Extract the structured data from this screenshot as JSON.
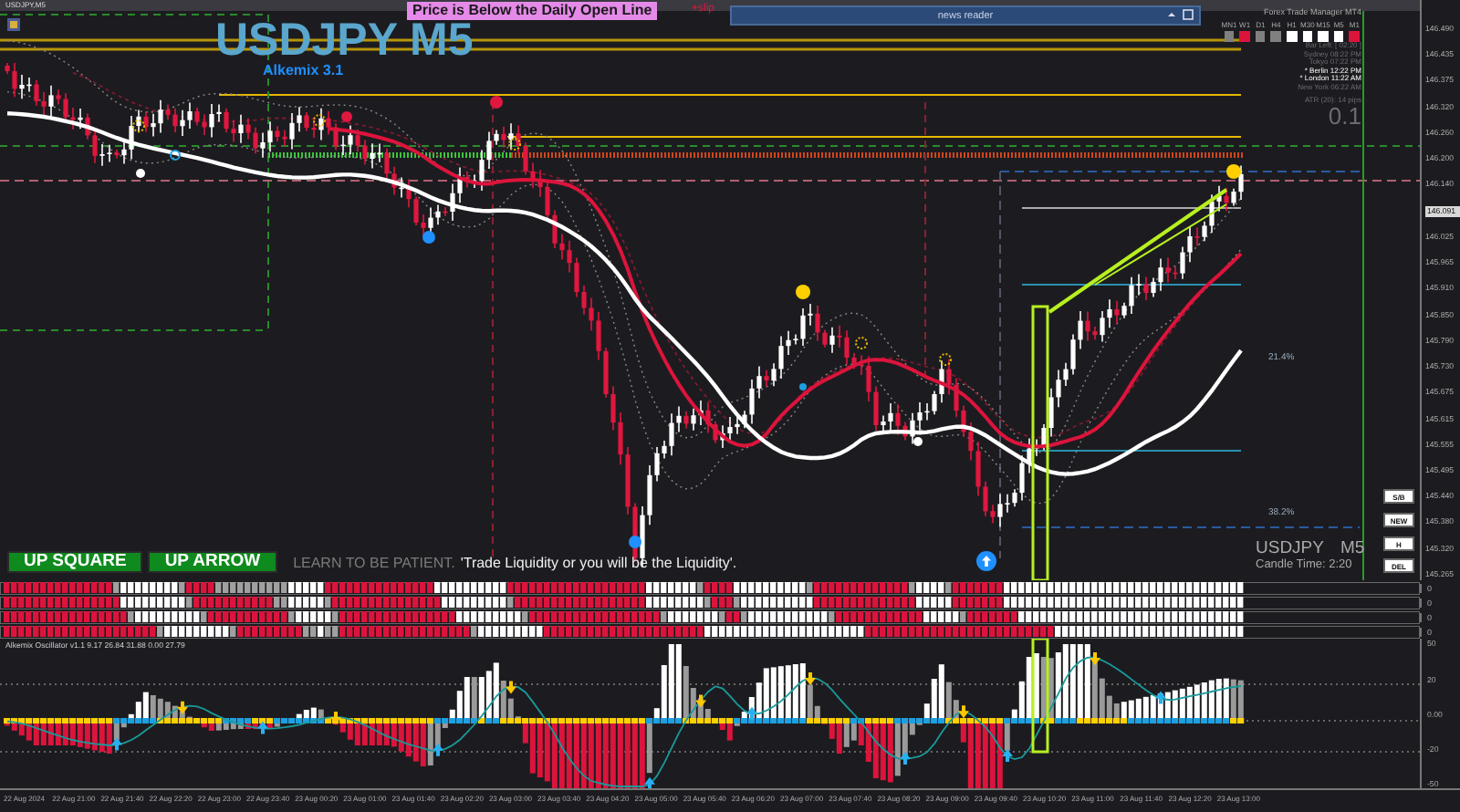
{
  "window": {
    "title": "USDJPY,M5"
  },
  "chart": {
    "symbol_title": "USDJPY M5",
    "subtitle": "Alkemix 3.1",
    "alert": "Price is Below the Daily Open Line",
    "alert_tag": "+slip",
    "fib_levels": [
      {
        "label": "21.4%"
      },
      {
        "label": "38.2%"
      }
    ],
    "price_axis": [
      {
        "label": "146.490",
        "current": false
      },
      {
        "label": "146.435",
        "current": false
      },
      {
        "label": "146.375",
        "current": false
      },
      {
        "label": "146.320",
        "current": false
      },
      {
        "label": "146.260",
        "current": false
      },
      {
        "label": "146.200",
        "current": false
      },
      {
        "label": "146.140",
        "current": false
      },
      {
        "label": "146.091",
        "current": true
      },
      {
        "label": "146.025",
        "current": false
      },
      {
        "label": "145.965",
        "current": false
      },
      {
        "label": "145.910",
        "current": false
      },
      {
        "label": "145.850",
        "current": false
      },
      {
        "label": "145.790",
        "current": false
      },
      {
        "label": "145.730",
        "current": false
      },
      {
        "label": "145.675",
        "current": false
      },
      {
        "label": "145.615",
        "current": false
      },
      {
        "label": "145.555",
        "current": false
      },
      {
        "label": "145.495",
        "current": false
      },
      {
        "label": "145.440",
        "current": false
      },
      {
        "label": "145.380",
        "current": false
      },
      {
        "label": "145.320",
        "current": false
      },
      {
        "label": "145.265",
        "current": false
      }
    ]
  },
  "news_reader": {
    "title": "news reader"
  },
  "trade_manager": {
    "title": "Forex Trade Manager MT4",
    "timeframes": [
      {
        "label": "MN1",
        "color": "#808080"
      },
      {
        "label": "W1",
        "color": "#dc143c"
      },
      {
        "label": "D1",
        "color": "#808080"
      },
      {
        "label": "H4",
        "color": "#808080"
      },
      {
        "label": "H1",
        "color": "#ffffff"
      },
      {
        "label": "M30",
        "color": "#ffffff"
      },
      {
        "label": "M15",
        "color": "#ffffff"
      },
      {
        "label": "M5",
        "color": "#ffffff"
      },
      {
        "label": "M1",
        "color": "#dc143c"
      }
    ],
    "sessions": [
      {
        "text": "Bar Left: [ 02:20 ]",
        "highlighted": false
      },
      {
        "text": "Sydney 08:22 PM",
        "highlighted": false
      },
      {
        "text": "Tokyo 07:22 PM",
        "highlighted": false
      },
      {
        "text": "* Berlin 12:22 PM",
        "highlighted": true
      },
      {
        "text": "* London 11:22 AM",
        "highlighted": true
      },
      {
        "text": "New York 06:22 AM",
        "highlighted": false
      }
    ],
    "atr": "ATR (20): 14 pips",
    "lot": "0.1"
  },
  "candle_info": {
    "symbol": "USDJPY",
    "timeframe": "M5",
    "candle_time": "Candle Time: 2:20"
  },
  "side_buttons": [
    "S/B",
    "NEW",
    "H",
    "DEL"
  ],
  "signals": [
    {
      "label": "UP SQUARE"
    },
    {
      "label": "UP ARROW"
    }
  ],
  "message": {
    "lead": "LEARN TO BE PATIENT.",
    "quote": "'Trade Liquidity or you will be the Liquidity'."
  },
  "heatmap": {
    "rows": [
      {
        "value": "0"
      },
      {
        "value": "0"
      },
      {
        "value": "0"
      },
      {
        "value": "0"
      }
    ]
  },
  "oscillator": {
    "label": "Alkemix Oscillator v1.1 9.17 26.84 31.88 0.00 27.79",
    "ticks": [
      "50",
      "20",
      "0.00",
      "-20",
      "-50"
    ]
  },
  "time_axis": [
    "22 Aug 2024",
    "22 Aug 21:00",
    "22 Aug 21:40",
    "22 Aug 22:20",
    "22 Aug 23:00",
    "22 Aug 23:40",
    "23 Aug 00:20",
    "23 Aug 01:00",
    "23 Aug 01:40",
    "23 Aug 02:20",
    "23 Aug 03:00",
    "23 Aug 03:40",
    "23 Aug 04:20",
    "23 Aug 05:00",
    "23 Aug 05:40",
    "23 Aug 06:20",
    "23 Aug 07:00",
    "23 Aug 07:40",
    "23 Aug 08:20",
    "23 Aug 09:00",
    "23 Aug 09:40",
    "23 Aug 10:20",
    "23 Aug 11:00",
    "23 Aug 11:40",
    "23 Aug 12:20",
    "23 Aug 13:00"
  ]
}
